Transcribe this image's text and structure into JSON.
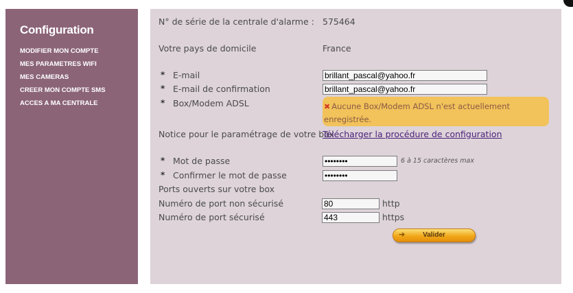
{
  "sidebar": {
    "title": "Configuration",
    "items": [
      {
        "label": "MODIFIER MON COMPTE"
      },
      {
        "label": "MES PARAMETRES WIFI"
      },
      {
        "label": "MES CAMERAS"
      },
      {
        "label": "CREER MON COMPTE SMS"
      },
      {
        "label": "ACCES A MA CENTRALE"
      }
    ]
  },
  "form": {
    "serial_label": "N° de série de la centrale d'alarme :",
    "serial_value": "575464",
    "country_label": "Votre pays de domicile",
    "country_value": "France",
    "required_mark": "*",
    "email_label": "E-mail",
    "email_value": "brillant_pascal@yahoo.fr",
    "email_confirm_label": "E-mail de confirmation",
    "email_confirm_value": "brillant_pascal@yahoo.fr",
    "box_label": "Box/Modem ADSL",
    "box_warning_icon": "✖",
    "box_warning": "Aucune Box/Modem ADSL n'est actuellement enregistrée.",
    "notice_label": "Notice pour le paramétrage de votre box",
    "notice_link": "Télécharger la procédure de configuration",
    "password_label": "Mot de passe",
    "password_value": "********",
    "password_hint": "6 à 15 caractères max",
    "password_confirm_label": "Confirmer le mot de passe",
    "password_confirm_value": "********",
    "ports_label": "Ports ouverts sur votre box",
    "port_http_label": "Numéro de port non sécurisé",
    "port_http_value": "80",
    "port_http_suffix": "http",
    "port_https_label": "Numéro de port sécurisé",
    "port_https_value": "443",
    "port_https_suffix": "https",
    "submit_icon": "➔",
    "submit_label": "Valider"
  }
}
